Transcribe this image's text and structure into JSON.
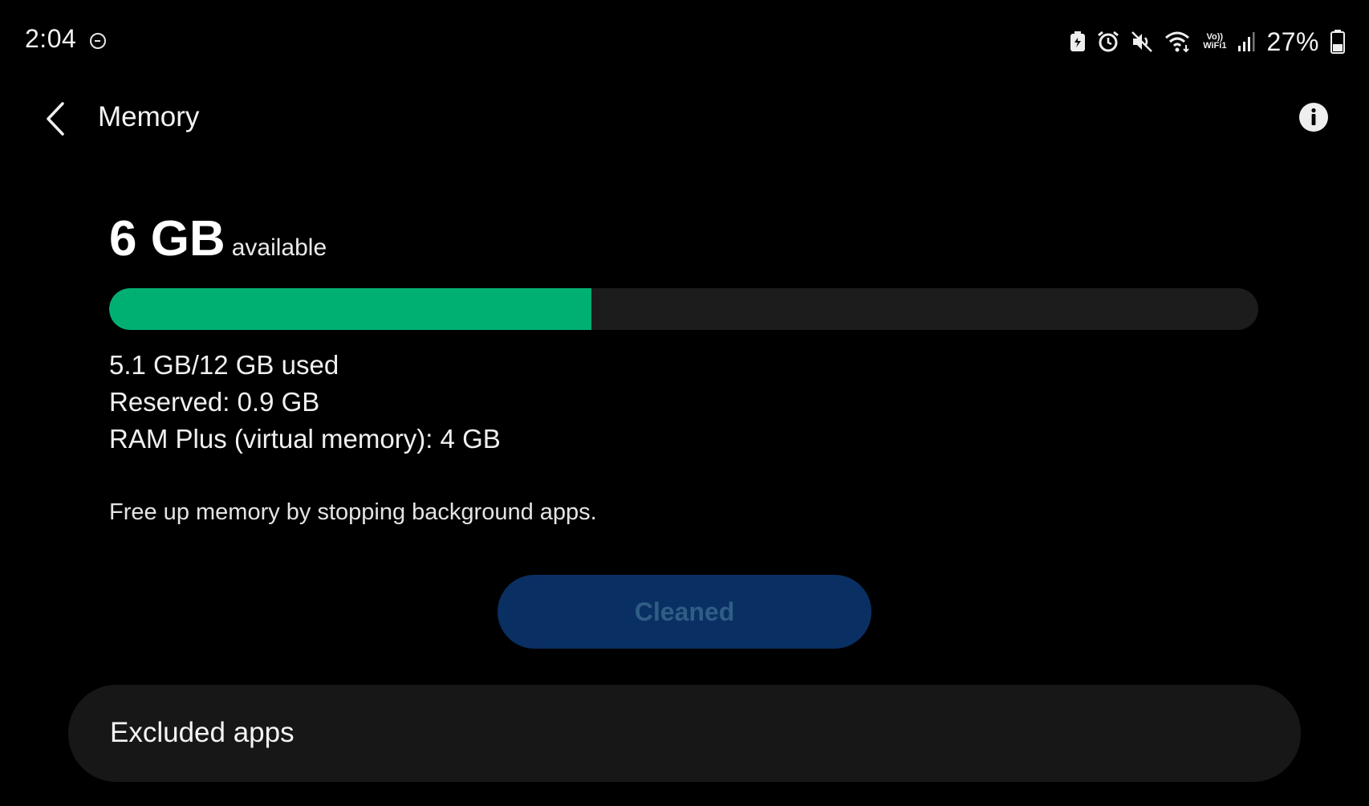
{
  "status_bar": {
    "time": "2:04",
    "battery_percent": "27%",
    "vowifi_top": "Vo))",
    "vowifi_bottom": "WiFi1",
    "icons": [
      "do-not-disturb-icon",
      "battery-saver-icon",
      "alarm-icon",
      "mute-icon",
      "wifi-icon",
      "vowifi-icon",
      "signal-icon",
      "battery-icon"
    ]
  },
  "header": {
    "title": "Memory",
    "back_icon": "chevron-left-icon",
    "info_icon": "info-icon"
  },
  "memory": {
    "available_value": "6 GB",
    "available_label": "available",
    "used_fraction": 0.42,
    "used_text": "5.1 GB/12 GB used",
    "reserved_text": "Reserved: 0.9 GB",
    "ram_plus_text": "RAM Plus (virtual memory): 4 GB"
  },
  "hint": "Free up memory by stopping background apps.",
  "clean_button": {
    "label": "Cleaned"
  },
  "excluded_apps": {
    "label": "Excluded apps"
  },
  "colors": {
    "background": "#000000",
    "bar_used": "#00b072",
    "bar_track": "#1c1c1c",
    "button_bg": "#0a2f63",
    "button_text": "#2f5d86",
    "card_bg": "#171717"
  }
}
